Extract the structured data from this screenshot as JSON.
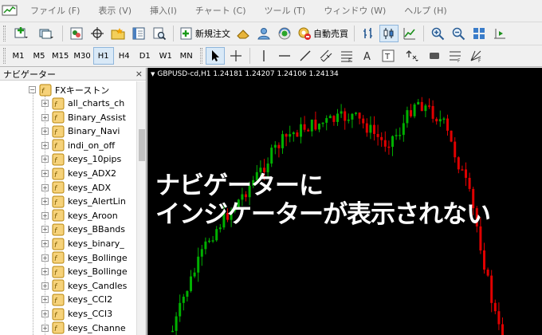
{
  "menubar": {
    "items": [
      "ファイル (F)",
      "表示 (V)",
      "挿入(I)",
      "チャート (C)",
      "ツール (T)",
      "ウィンドウ (W)",
      "ヘルプ (H)"
    ]
  },
  "toolbar": {
    "new_order": "新規注文",
    "auto_trading": "自動売買"
  },
  "timeframes": [
    "M1",
    "M5",
    "M15",
    "M30",
    "H1",
    "H4",
    "D1",
    "W1",
    "MN"
  ],
  "active_timeframe": "H1",
  "navigator": {
    "title": "ナビゲーター",
    "close": "×",
    "root_folder": "FXキーストン",
    "items": [
      "all_charts_ch",
      "Binary_Assist",
      "Binary_Navi",
      "indi_on_off",
      "keys_10pips",
      "keys_ADX2",
      "keys_ADX",
      "keys_AlertLin",
      "keys_Aroon",
      "keys_BBands",
      "keys_binary_",
      "keys_Bollinge",
      "keys_Bollinge",
      "keys_Candles",
      "keys_CCI2",
      "keys_CCI3",
      "keys_Channe"
    ]
  },
  "chart": {
    "header": "GBPUSD-cd,H1  1.24181 1.24207 1.24106 1.24134",
    "overlay_line1": "ナビゲーターに",
    "overlay_line2": "インジケーターが表示されない",
    "up_color": "#00b000",
    "down_color": "#e00000"
  }
}
